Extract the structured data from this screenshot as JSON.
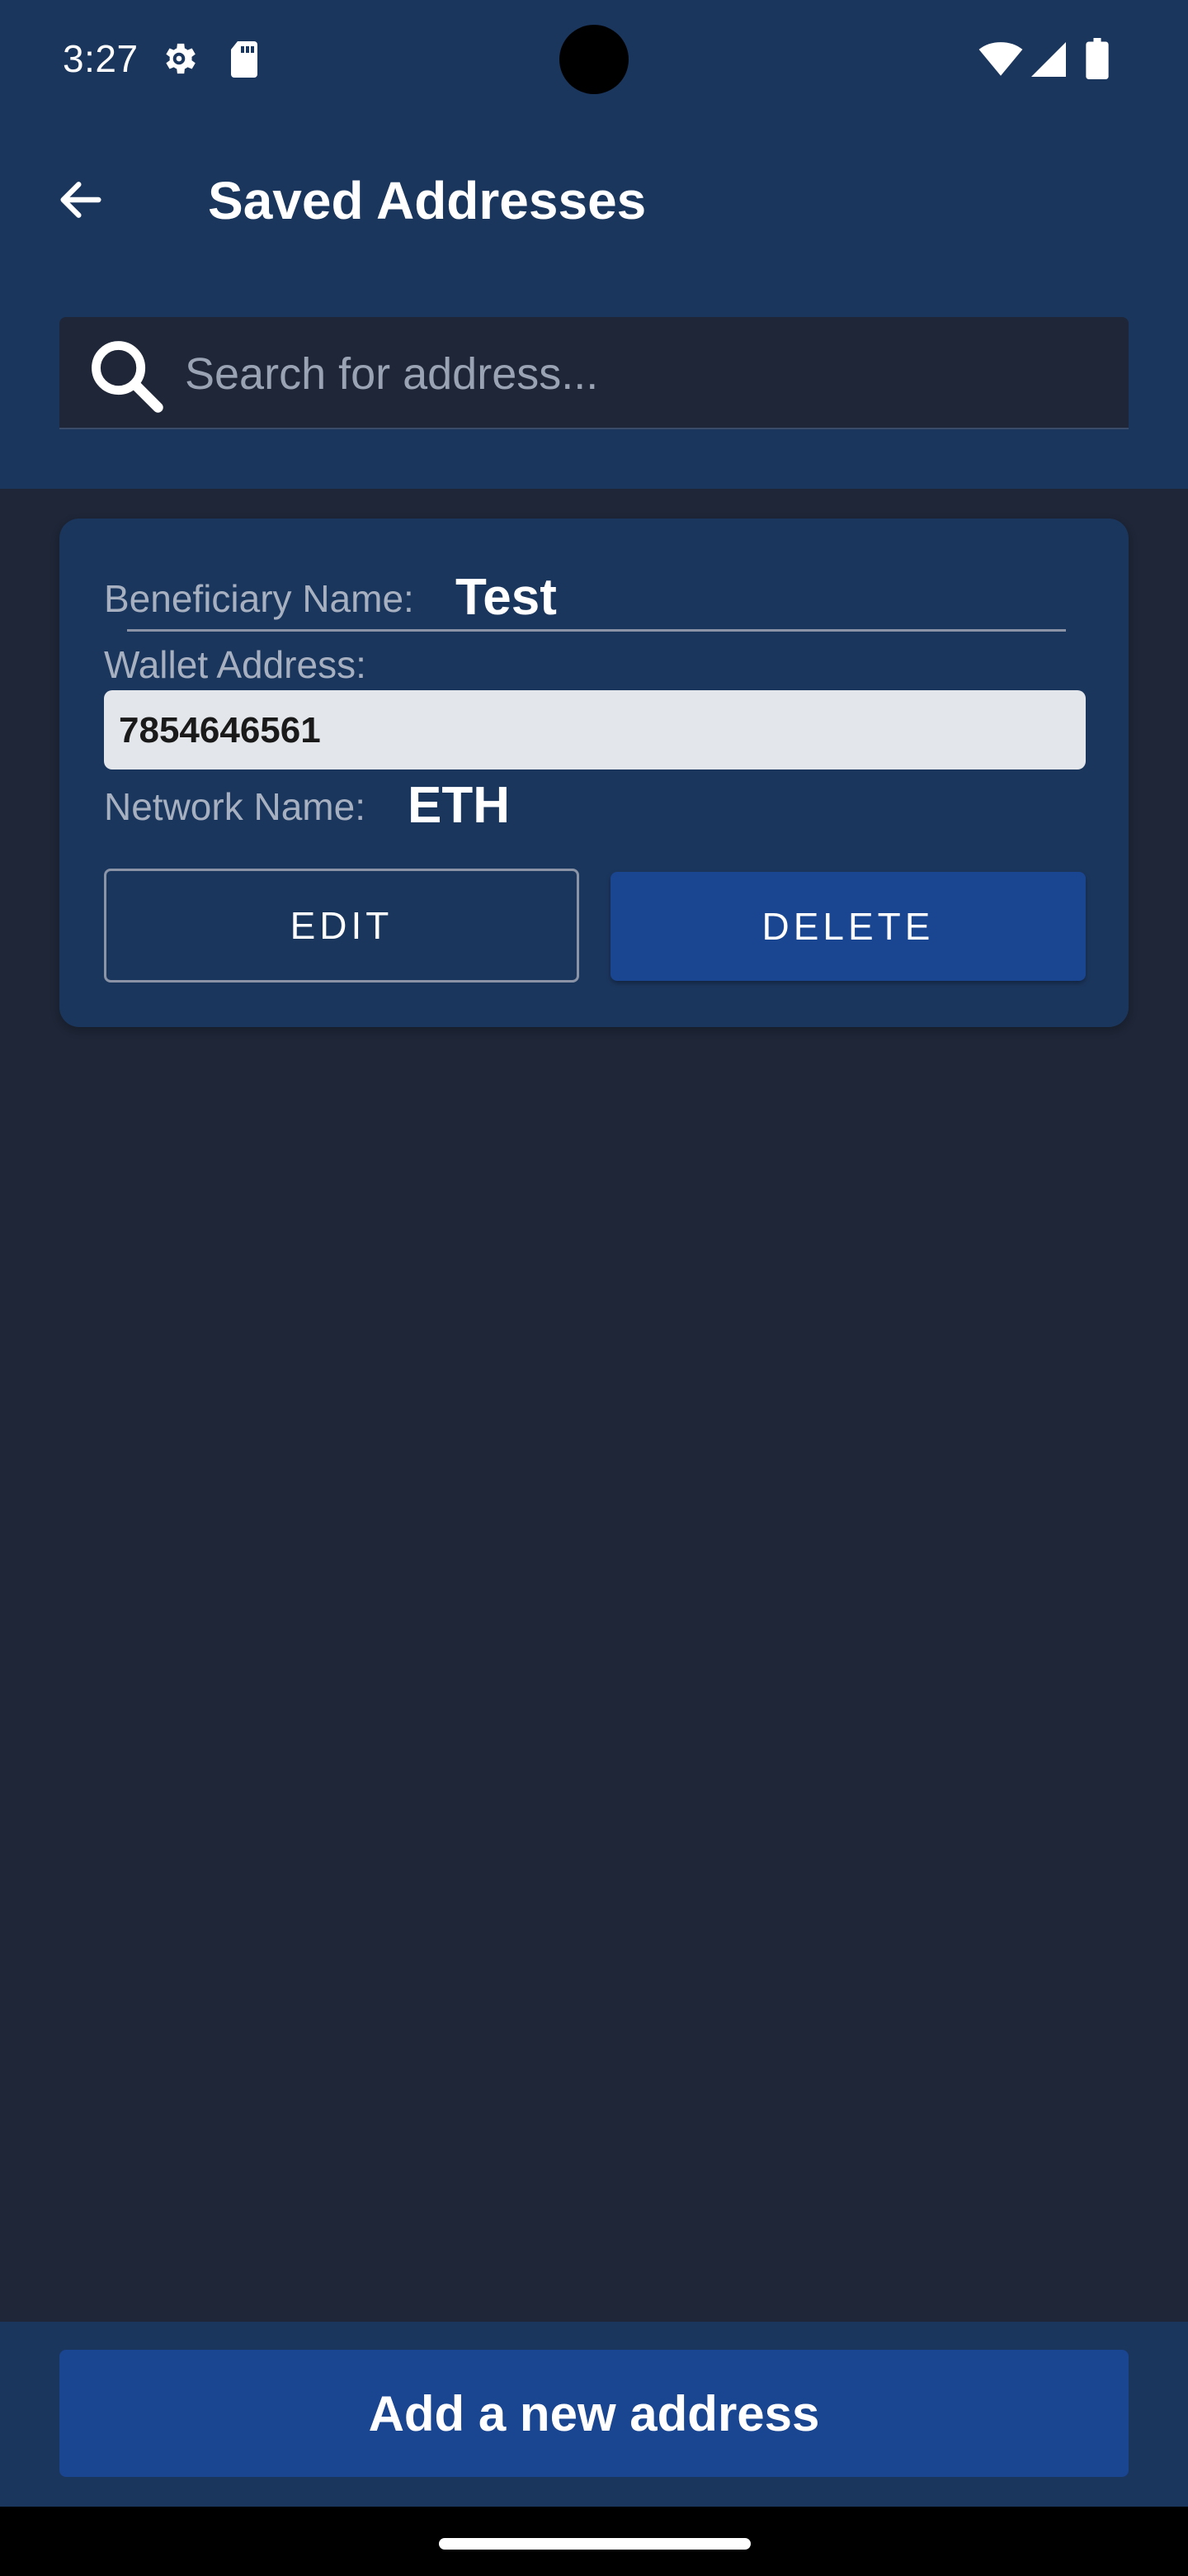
{
  "status_bar": {
    "time": "3:27",
    "icons": [
      "gear-icon",
      "sd-card-icon",
      "wifi-icon",
      "signal-icon",
      "battery-icon"
    ]
  },
  "toolbar": {
    "back_icon": "arrow-left-icon",
    "title": "Saved Addresses"
  },
  "search": {
    "icon": "search-icon",
    "placeholder": "Search for address...",
    "value": ""
  },
  "addresses": [
    {
      "beneficiary_label": "Beneficiary Name:",
      "beneficiary_name": "Test",
      "wallet_label": "Wallet Address:",
      "wallet_address": "7854646561",
      "network_label": "Network Name:",
      "network_name": "ETH",
      "edit_label": "EDIT",
      "delete_label": "DELETE"
    }
  ],
  "footer": {
    "add_button_label": "Add a new address"
  },
  "colors": {
    "header_bg": "#1b365d",
    "page_bg": "#1e2637",
    "card_bg": "#1b365d",
    "primary_button": "#1a4591",
    "wallet_field_bg": "#e3e6ea"
  }
}
